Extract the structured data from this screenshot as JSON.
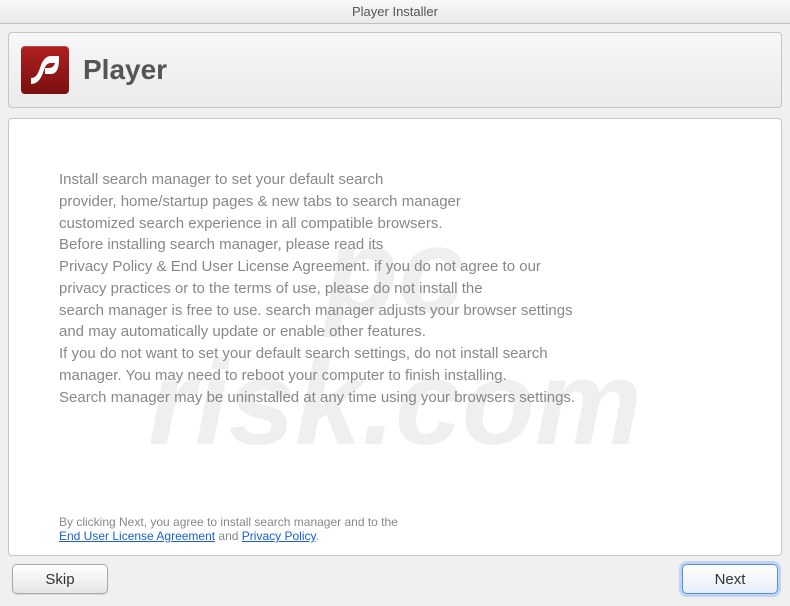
{
  "window": {
    "title": "Player Installer"
  },
  "header": {
    "app_name": "Player"
  },
  "body": {
    "text": "Install search manager to set your default search\nprovider, home/startup pages & new tabs to search manager\ncustomized search experience in all compatible browsers.\nBefore installing search manager, please read its\nPrivacy Policy & End User License Agreement. if you do not agree to our\nprivacy practices or to the terms of use, please do not install the\nsearch manager is free to use. search manager adjusts your browser settings\nand may automatically update or enable other features.\nIf you do not want to set your default search settings, do not install search\nmanager. You may need to reboot your computer to finish installing.\nSearch manager may be uninstalled at any time using your browsers settings."
  },
  "footer": {
    "prefix": "By clicking Next, you agree to install search manager and to the",
    "eula_label": "End User License Agreement",
    "and": " and ",
    "privacy_label": "Privacy Policy"
  },
  "buttons": {
    "skip": "Skip",
    "next": "Next"
  },
  "watermark": {
    "line1": "pc",
    "line2": "risk.com"
  }
}
